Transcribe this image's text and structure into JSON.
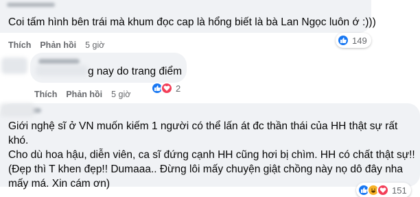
{
  "comments": [
    {
      "text": "Coi tấm hình bên trái mà khum đọc cap là hổng biết là bà Lan Ngọc luôn ớ :)))",
      "actions": {
        "like": "Thích",
        "reply": "Phản hồi",
        "time": "5 giờ"
      },
      "reactions": {
        "icons": [
          "like-icon"
        ],
        "count": "149"
      }
    },
    {
      "text": "g nay do trang điểm",
      "actions": {
        "like": "Thích",
        "reply": "Phản hồi",
        "time": "5 giờ"
      },
      "reactions": {
        "icons": [
          "like-icon",
          "love-icon"
        ],
        "count": "2"
      }
    },
    {
      "lines": [
        "Giới nghệ sĩ ở VN muốn kiếm 1 người có thể lấn át đc thần thái của HH thật sự rất khó.",
        "Cho dù hoa hậu, diễn viên, ca sĩ đứng cạnh HH cũng hơi bị chìm. HH có chất thật sự!!",
        "(Đẹp thì T khen đẹp!! Dumaaa.. Đừng lôi mấy chuyện giật chồng này nọ dô đây nha",
        "mấy má. Xin cám ơn)"
      ],
      "reactions": {
        "icons": [
          "like-icon",
          "haha-icon",
          "love-icon"
        ],
        "count": "151"
      }
    }
  ],
  "colors": {
    "bubble": "#f0f2f5",
    "meta": "#65676b",
    "like": "#1877f2",
    "love": "#f33e58",
    "haha": "#f7b125"
  }
}
